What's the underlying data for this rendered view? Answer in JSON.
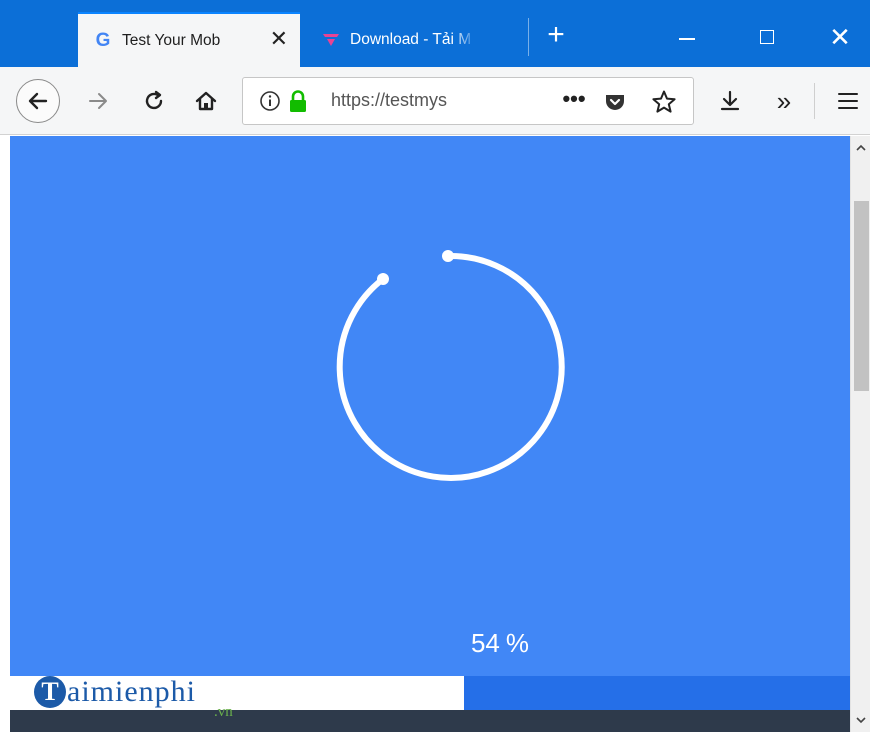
{
  "tabs": [
    {
      "title": "Test Your Mob",
      "favicon": "google-g-icon",
      "close": "✕",
      "active": true
    },
    {
      "title": "Download - Tải M",
      "favicon": "download-site-icon",
      "active": false
    }
  ],
  "new_tab_symbol": "+",
  "window_controls": {
    "close": "✕"
  },
  "url": {
    "text": "https://testmys"
  },
  "toolbar": {
    "overflow": "»",
    "more": "•••"
  },
  "content": {
    "progress": {
      "value": 54,
      "unit": "%"
    },
    "ring_color": "#ffffff",
    "background_color": "#4187f6"
  },
  "watermark": {
    "badge": "T",
    "brand": "aimienphi",
    "domain": ".vn"
  },
  "colors": {
    "tabbar": "#0c6fd7",
    "accent": "#0a84ff",
    "lock": "#12bc00",
    "progress_track": "#256fe8"
  }
}
